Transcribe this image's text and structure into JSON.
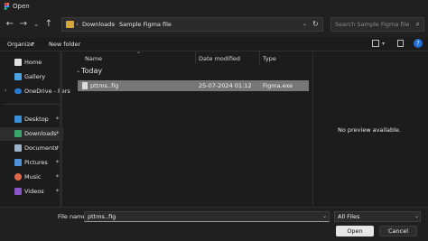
{
  "window": {
    "title": "Open"
  },
  "address": {
    "segments": [
      "Downloads",
      "Sample Figma file"
    ]
  },
  "search": {
    "placeholder": "Search Sample Figma file"
  },
  "toolbar": {
    "organize": "Organize",
    "new_folder": "New folder"
  },
  "sidebar": {
    "items": [
      {
        "label": "Home",
        "icon": "home-icon",
        "color": "#e0e0e0"
      },
      {
        "label": "Gallery",
        "icon": "gallery-icon",
        "color": "#4aa3e0"
      },
      {
        "label": "OneDrive - Pers",
        "icon": "cloud-icon",
        "color": "#2a7ad5"
      },
      {
        "label": "Desktop",
        "icon": "desktop-icon",
        "color": "#3b8fd8"
      },
      {
        "label": "Downloads",
        "icon": "download-icon",
        "color": "#3aa36b"
      },
      {
        "label": "Documents",
        "icon": "documents-icon",
        "color": "#9db3c9"
      },
      {
        "label": "Pictures",
        "icon": "pictures-icon",
        "color": "#4f8fd6"
      },
      {
        "label": "Music",
        "icon": "music-icon",
        "color": "#e2674b"
      },
      {
        "label": "Videos",
        "icon": "videos-icon",
        "color": "#8a55c9"
      }
    ]
  },
  "columns": {
    "name": "Name",
    "date": "Date modified",
    "type": "Type"
  },
  "group": {
    "label": "Today"
  },
  "files": [
    {
      "name": "pttms..fig",
      "date": "25-07-2024 01:12",
      "type": "Figma.exe"
    }
  ],
  "preview": {
    "text": "No preview available."
  },
  "footer": {
    "file_name_label": "File name:",
    "file_name_value": "pttms..fig",
    "filter": "All Files",
    "open": "Open",
    "cancel": "Cancel"
  }
}
